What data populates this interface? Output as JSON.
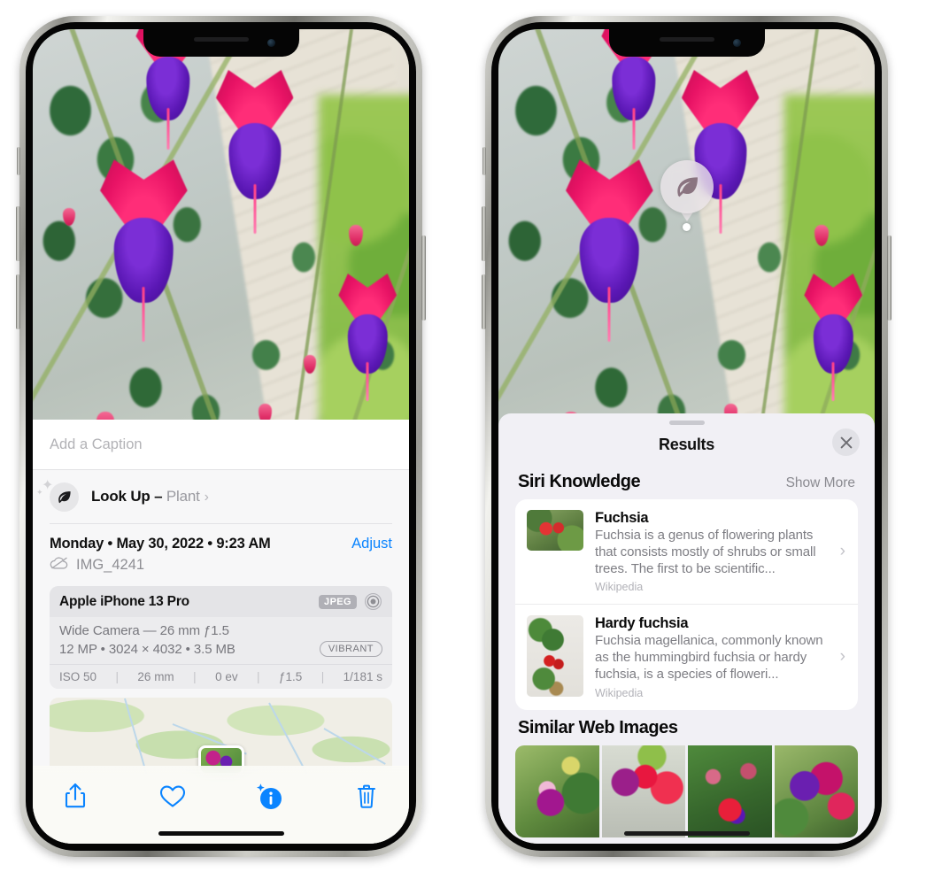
{
  "left_phone": {
    "caption_placeholder": "Add a Caption",
    "lookup": {
      "label": "Look Up – ",
      "subject": "Plant",
      "chevron": "›",
      "icon": "leaf-icon"
    },
    "date": "Monday • May 30, 2022 • 9:23 AM",
    "adjust_label": "Adjust",
    "file_name": "IMG_4241",
    "metadata": {
      "device": "Apple iPhone 13 Pro",
      "format_badge": "JPEG",
      "lens": "Wide Camera — 26 mm ƒ1.5",
      "specs": "12 MP • 3024 × 4032 • 3.5 MB",
      "style_badge": "VIBRANT",
      "exif": [
        "ISO 50",
        "26 mm",
        "0 ev",
        "ƒ1.5",
        "1/181 s"
      ]
    },
    "toolbar": {
      "share_label": "share-icon",
      "favorite_label": "heart-icon",
      "info_label": "info-sparkle-icon",
      "delete_label": "trash-icon"
    }
  },
  "right_phone": {
    "visual_lookup_badge": "leaf-icon",
    "sheet_title": "Results",
    "close_label": "close-icon",
    "sections": [
      {
        "title": "Siri Knowledge",
        "action": "Show More",
        "cards": [
          {
            "title": "Fuchsia",
            "description": "Fuchsia is a genus of flowering plants that consists mostly of shrubs or small trees. The first to be scientific...",
            "source": "Wikipedia",
            "chevron": "›"
          },
          {
            "title": "Hardy fuchsia",
            "description": "Fuchsia magellanica, commonly known as the hummingbird fuchsia or hardy fuchsia, is a species of floweri...",
            "source": "Wikipedia",
            "chevron": "›"
          }
        ]
      },
      {
        "title": "Similar Web Images",
        "thumbnails": [
          "fuchsia-web-image-1",
          "fuchsia-web-image-2",
          "fuchsia-web-image-3",
          "fuchsia-web-image-4"
        ]
      }
    ]
  },
  "colors": {
    "accent_blue": "#0a84ff",
    "sheet_background": "#f1f0f5",
    "panel_background": "#f7f7f8",
    "secondary_text": "#8e8e93"
  }
}
